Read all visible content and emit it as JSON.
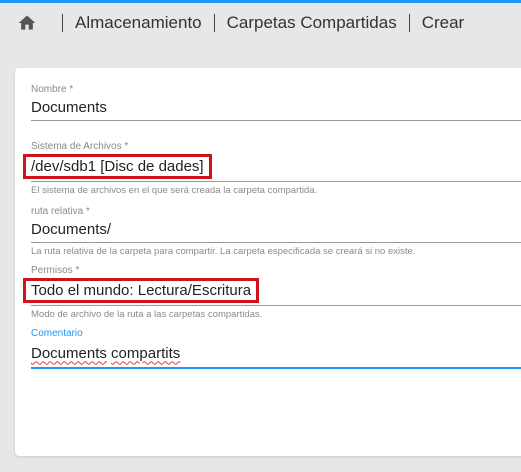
{
  "breadcrumb": {
    "items": [
      "Almacenamiento",
      "Carpetas Compartidas",
      "Crear"
    ]
  },
  "form": {
    "name": {
      "label": "Nombre *",
      "value": "Documents"
    },
    "filesystem": {
      "label": "Sistema de Archivos *",
      "value": "/dev/sdb1 [Disc de dades]",
      "hint": "El sistema de archivos en el que será creada la carpeta compartida."
    },
    "relative_path": {
      "label": "ruta relativa *",
      "value": "Documents/",
      "hint": "La ruta relativa de la carpeta para compartir. La carpeta especificada se creará si no existe."
    },
    "permissions": {
      "label": "Permisos *",
      "value": "Todo el mundo: Lectura/Escritura",
      "hint": "Modo de archivo de la ruta a las carpetas compartidas."
    },
    "comment": {
      "label": "Comentario",
      "value_word1": "Documents",
      "value_word2": "compartits"
    }
  },
  "colors": {
    "accent": "#2196f3",
    "highlight_border": "#d0121b",
    "background": "#e6e7e9"
  },
  "icons": [
    "home-icon"
  ]
}
